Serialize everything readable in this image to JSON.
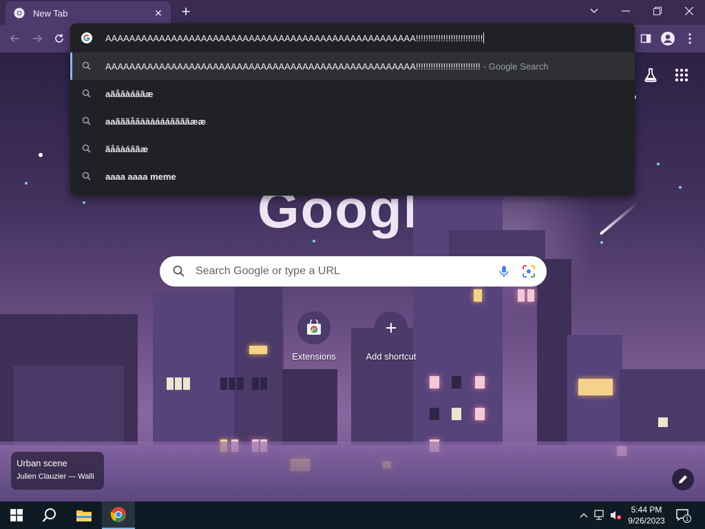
{
  "browser": {
    "tab": {
      "title": "New Tab"
    },
    "window_controls": [
      "minimize",
      "restore",
      "close"
    ]
  },
  "omnibox": {
    "input_value": "AAAAAAAAAAAAAAAAAAAAAAAAAAAAAAAAAAAAAAAAAAAAAAAAAAAA!!!!!!!!!!!!!!!!!!!!!!!!!!!",
    "suggestions": [
      {
        "text": "AAAAAAAAAAAAAAAAAAAAAAAAAAAAAAAAAAAAAAAAAAAAAAAAAAAA!!!!!!!!!!!!!!!!!!!!!!!!!!",
        "hint": "- Google Search",
        "selected": true
      },
      {
        "text": "aãåâàáâãæ"
      },
      {
        "text": "aaãããåâàààáááâãããææ"
      },
      {
        "text": "ãåâàáâãæ"
      },
      {
        "text": "aaaa aaaa meme"
      }
    ]
  },
  "ntp": {
    "logo_text": "Google",
    "search_placeholder": "Search Google or type a URL",
    "shortcuts": [
      {
        "label": "Extensions",
        "icon": "chrome-web-store-icon"
      },
      {
        "label": "Add shortcut",
        "icon": "plus-icon"
      }
    ],
    "attribution": {
      "title": "Urban scene",
      "author": "Julien Clauzier — Walli"
    }
  },
  "taskbar": {
    "time": "5:44 PM",
    "date": "9/26/2023",
    "notification_count": "1",
    "pinned": [
      "windows-start-icon",
      "search-icon",
      "file-explorer-icon",
      "chrome-icon"
    ]
  },
  "colors": {
    "omnibox_bg": "#202124",
    "selected_row": "#2f3033",
    "accent": "#8ab4f8",
    "toolbar": "#4e3b6e",
    "tabstrip": "#3a2b53",
    "taskbar": "#0f1b24"
  }
}
